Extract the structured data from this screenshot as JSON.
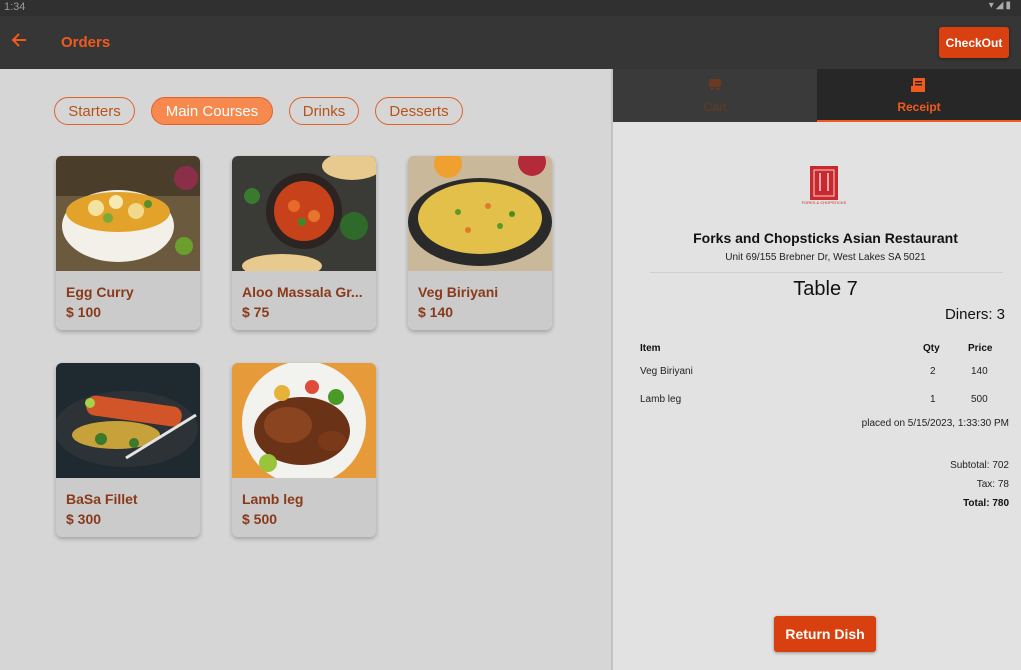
{
  "status_bar": {
    "time": "1:34",
    "icons": "wifi-icon signal-icon battery-icon"
  },
  "appbar": {
    "title": "Orders",
    "checkout_label": "CheckOut",
    "accent": "#f05a1e"
  },
  "categories": [
    {
      "label": "Starters",
      "active": false
    },
    {
      "label": "Main Courses",
      "active": true
    },
    {
      "label": "Drinks",
      "active": false
    },
    {
      "label": "Desserts",
      "active": false
    }
  ],
  "dishes": [
    {
      "name": "Egg Curry",
      "price": "$ 100"
    },
    {
      "name": "Aloo Massala Gr...",
      "price": "$ 75"
    },
    {
      "name": "Veg Biriyani",
      "price": "$ 140"
    },
    {
      "name": "BaSa Fillet",
      "price": "$ 300"
    },
    {
      "name": "Lamb leg",
      "price": "$ 500"
    }
  ],
  "right_tabs": {
    "cart": "Cart",
    "receipt": "Receipt"
  },
  "receipt": {
    "logo_text": "FORKS & CHOPSTICKS",
    "restaurant": "Forks and Chopsticks Asian Restaurant",
    "address": "Unit 69/155 Brebner Dr, West Lakes SA 5021",
    "table": "Table 7",
    "diners": "Diners: 3",
    "headers": {
      "item": "Item",
      "qty": "Qty",
      "price": "Price"
    },
    "items": [
      {
        "item": "Veg Biriyani",
        "qty": "2",
        "price": "140"
      },
      {
        "item": "Lamb leg",
        "qty": "1",
        "price": "500"
      }
    ],
    "placed": "placed on 5/15/2023, 1:33:30 PM",
    "subtotal": "Subtotal: 702",
    "tax": "Tax: 78",
    "total": "Total: 780"
  },
  "return_label": "Return Dish"
}
